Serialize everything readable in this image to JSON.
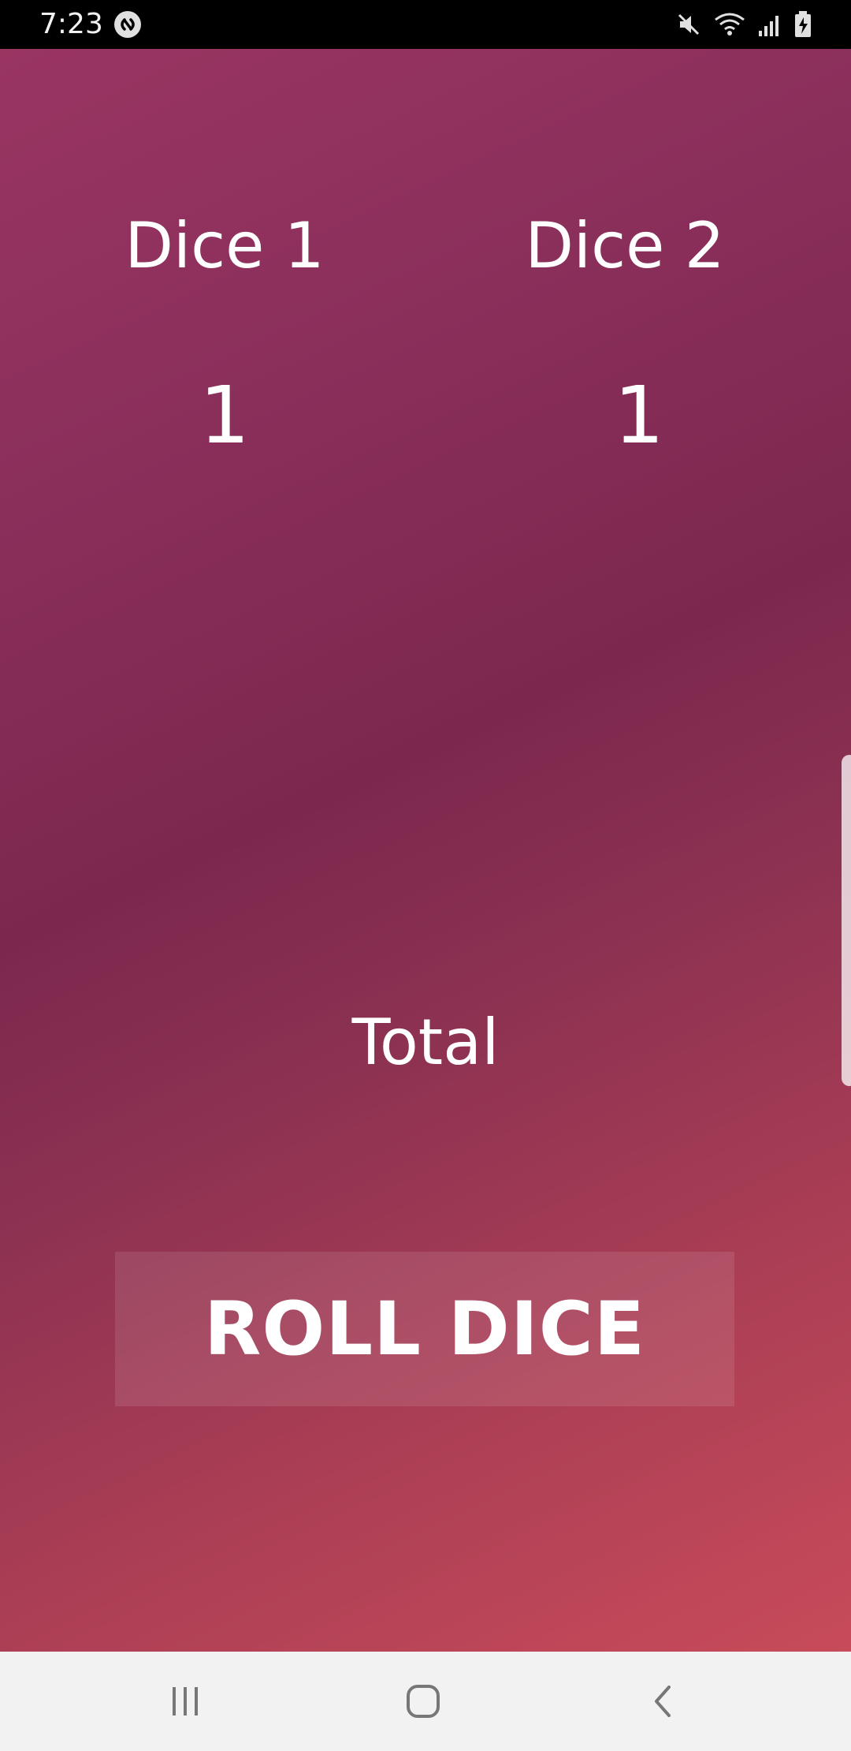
{
  "status_bar": {
    "time": "7:23",
    "left_icons": [
      "shazam-icon"
    ],
    "right_icons": [
      "mute-icon",
      "wifi-icon",
      "signal-icon",
      "battery-charging-icon"
    ]
  },
  "app": {
    "dice1_label": "Dice 1",
    "dice2_label": "Dice 2",
    "dice1_value": "1",
    "dice2_value": "1",
    "total_label": "Total",
    "roll_button_label": "ROLL DICE",
    "colors": {
      "gradient_top": "#9a3562",
      "gradient_middle": "#7c284e",
      "gradient_bottom": "#c74b5a",
      "text": "#ffffff"
    }
  },
  "nav_bar": {
    "buttons": [
      "recent-apps-icon",
      "home-icon",
      "back-icon"
    ]
  }
}
